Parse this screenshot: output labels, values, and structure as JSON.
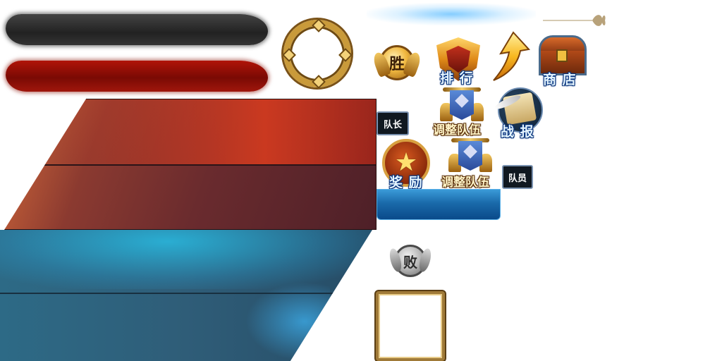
{
  "sprite_sheet": {
    "labels": {
      "win_char": "胜",
      "lose_char": "败",
      "rank": "排 行",
      "shop": "商 店",
      "adjust_team_1": "调整队伍",
      "adjust_team_2": "调整队伍",
      "battle_report": "战 报",
      "reward": "奖 励",
      "captain_tag": "队长",
      "member_tag": "队员",
      "star_glyph": "★"
    },
    "icons": [
      "dark-brush-stroke",
      "red-brush-stroke",
      "gold-ring-frame",
      "win-medal-icon",
      "rank-shield-icon",
      "arrow-up-icon",
      "treasure-chest-icon",
      "team-banner-icon",
      "battle-report-scroll-icon",
      "reward-star-medal-icon",
      "lose-medal-icon",
      "filigree-ornament-icon"
    ],
    "colors": {
      "red_panel": "#8b3a30",
      "blue_panel": "#2f5d78",
      "gold": "#c99a3a",
      "label_glow": "#0a3a8a",
      "blue_button": "#1a6aaa"
    }
  }
}
